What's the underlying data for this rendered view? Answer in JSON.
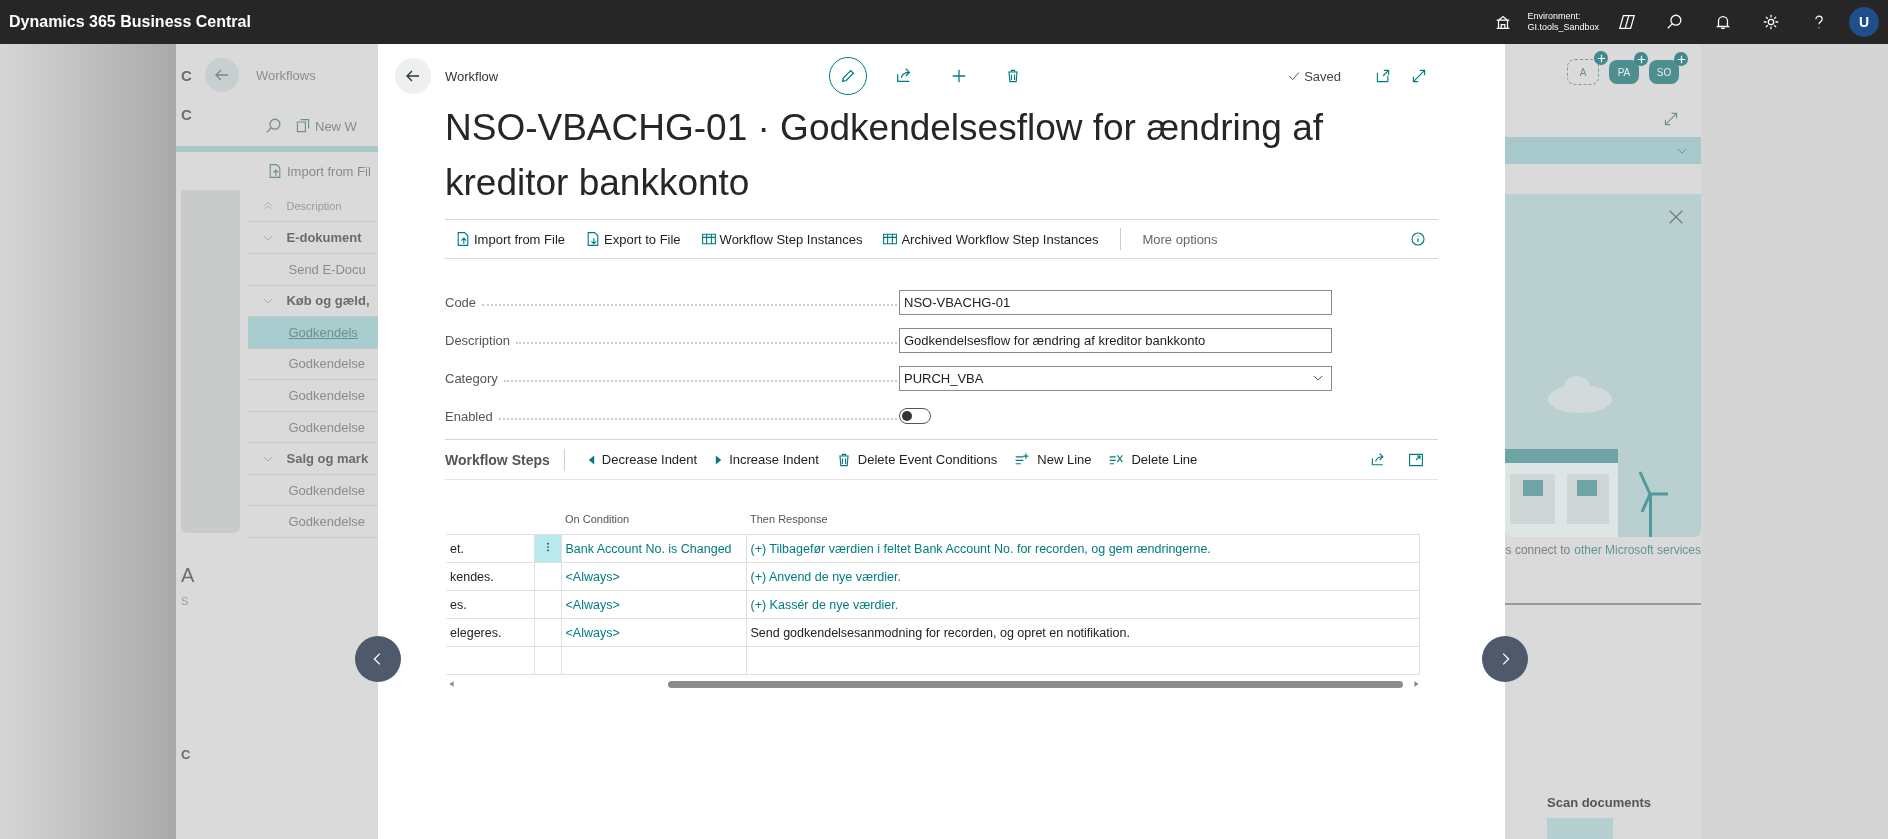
{
  "top_bar": {
    "app_title": "Dynamics 365 Business Central",
    "environment_label": "Environment:",
    "environment_name": "GI.tools_Sandbox",
    "user_initial": "U"
  },
  "background_page": {
    "side_letters": [
      "C",
      "C"
    ],
    "title": "Workflows",
    "new_action": "New W",
    "import_action": "Import from Fil",
    "list_header": "Description",
    "list_rows": [
      {
        "kind": "group",
        "text": "E-dokument",
        "selected": false
      },
      {
        "kind": "item",
        "text": "Send E-Docu",
        "selected": false
      },
      {
        "kind": "group",
        "text": "Køb og gæld,",
        "selected": false
      },
      {
        "kind": "item",
        "text": "Godkendels",
        "selected": true
      },
      {
        "kind": "item",
        "text": "Godkendelse",
        "selected": false
      },
      {
        "kind": "item",
        "text": "Godkendelse",
        "selected": false
      },
      {
        "kind": "item",
        "text": "Godkendelse",
        "selected": false
      },
      {
        "kind": "group",
        "text": "Salg og mark",
        "selected": false
      },
      {
        "kind": "item",
        "text": "Godkendelse",
        "selected": false
      },
      {
        "kind": "item",
        "text": "Godkendelse",
        "selected": false
      }
    ],
    "lower_heading": "A",
    "lower_letter": "S",
    "bottom_letter": "C",
    "avatars": [
      {
        "initials": "A",
        "kind": "outline"
      },
      {
        "initials": "PA",
        "kind": "filled"
      },
      {
        "initials": "SO",
        "kind": "filled"
      }
    ],
    "promo_text": "s connect to",
    "promo_link": "other Microsoft services",
    "scan_title": "Scan documents"
  },
  "modal": {
    "breadcrumb": "Workflow",
    "saved": "Saved",
    "title": "NSO-VBACHG-01 · Godkendelsesflow for ændring af kreditor bankkonto",
    "actions": [
      {
        "label": "Import from File"
      },
      {
        "label": "Export to File"
      },
      {
        "label": "Workflow Step Instances"
      },
      {
        "label": "Archived Workflow Step Instances"
      }
    ],
    "more_options": "More options",
    "fields": [
      {
        "label": "Code",
        "kind": "text",
        "value": "NSO-VBACHG-01"
      },
      {
        "label": "Description",
        "kind": "text",
        "value": "Godkendelsesflow for ændring af kreditor bankkonto"
      },
      {
        "label": "Category",
        "kind": "select",
        "value": "PURCH_VBA"
      },
      {
        "label": "Enabled",
        "kind": "toggle",
        "on": false
      }
    ],
    "steps": {
      "title": "Workflow Steps",
      "actions": [
        {
          "label": "Decrease Indent"
        },
        {
          "label": "Increase Indent"
        },
        {
          "label": "Delete Event Conditions"
        },
        {
          "label": "New Line"
        },
        {
          "label": "Delete Line"
        }
      ],
      "columns": [
        {
          "label": "On Condition"
        },
        {
          "label": "Then Response"
        }
      ],
      "rows": [
        {
          "column_1": "et.",
          "selected": true,
          "condition": "Bank Account No. is Changed",
          "response": "(+) Tilbagefør værdien i feltet Bank Account No. for recorden, og gem ændringerne.",
          "response_is_link": true
        },
        {
          "column_1": "kendes.",
          "selected": false,
          "condition": "<Always>",
          "response": "(+) Anvend de nye værdier.",
          "response_is_link": true
        },
        {
          "column_1": "es.",
          "selected": false,
          "condition": "<Always>",
          "response": "(+) Kassér de nye værdier.",
          "response_is_link": true
        },
        {
          "column_1": "elegeres.",
          "selected": false,
          "condition": "<Always>",
          "response": "Send godkendelsesanmodning for recorden, og opret en notifikation.",
          "response_is_link": false
        }
      ]
    }
  }
}
